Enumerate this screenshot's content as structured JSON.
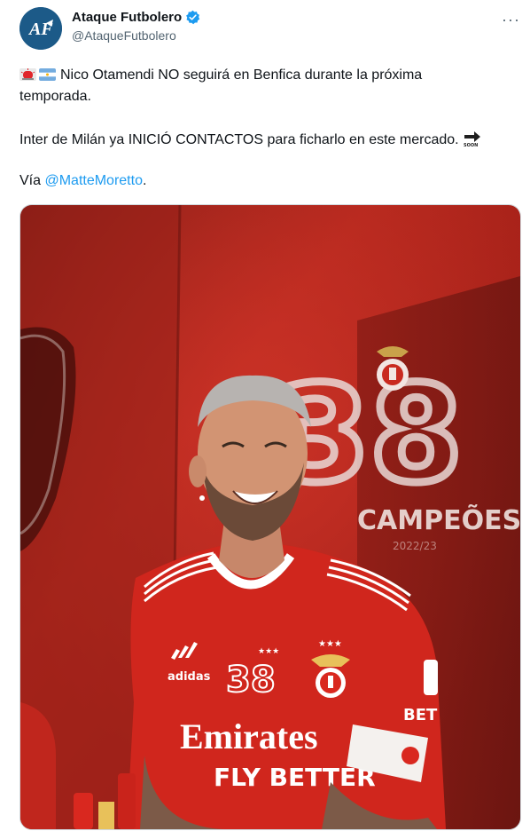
{
  "account": {
    "name": "Ataque Futbolero",
    "handle": "@AtaqueFutbolero",
    "avatar_text": "AF",
    "verified_icon": "verified-badge-icon"
  },
  "menu": {
    "more_label": "···"
  },
  "tweet": {
    "flags": [
      "siren-emoji",
      "argentina-flag-emoji"
    ],
    "line1": "Nico Otamendi NO seguirá en Benfica durante la próxima",
    "line2": "temporada.",
    "line3": "Inter de Milán ya INICIÓ CONTACTOS para ficharlo en este mercado.",
    "soon_icon": "soon-arrow-emoji",
    "via_prefix": "Vía ",
    "mention": "@MatteMoretto",
    "via_suffix": "."
  },
  "media": {
    "type": "photo",
    "backdrop_number": "38",
    "backdrop_text": "CAMPEÕES",
    "backdrop_year": "2022/23",
    "jersey_number": "38",
    "sponsor_line1": "Emirates",
    "sponsor_line2": "FLY BETTER",
    "kit_brand": "adidas",
    "sleeve_text": "BET"
  },
  "colors": {
    "handle_gray": "#536471",
    "link_blue": "#1d9bf0",
    "verified_blue": "#1d9bf0",
    "benfica_red": "#d7261e"
  }
}
